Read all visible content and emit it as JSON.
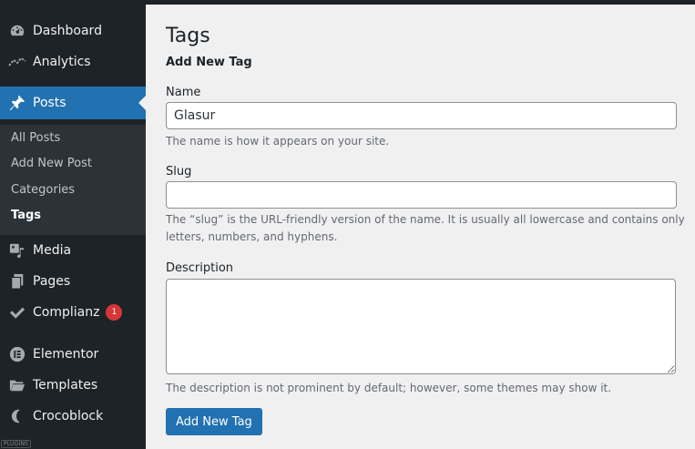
{
  "sidebar": {
    "menu": [
      {
        "label": "Dashboard",
        "icon": "dashboard-icon"
      },
      {
        "label": "Analytics",
        "icon": "analytics-icon"
      },
      {
        "label": "Posts",
        "icon": "pushpin-icon",
        "active": true
      },
      {
        "label": "Media",
        "icon": "media-icon"
      },
      {
        "label": "Pages",
        "icon": "pages-icon"
      },
      {
        "label": "Complianz",
        "icon": "checkmark-icon",
        "badge": "1"
      },
      {
        "label": "Elementor",
        "icon": "elementor-icon"
      },
      {
        "label": "Templates",
        "icon": "folder-icon"
      },
      {
        "label": "Crocoblock",
        "icon": "crocoblock-icon"
      }
    ],
    "posts_submenu": [
      "All Posts",
      "Add New Post",
      "Categories",
      "Tags"
    ],
    "current_submenu": "Tags",
    "footer_tag": "PLUGINS"
  },
  "main": {
    "page_title": "Tags",
    "form_title": "Add New Tag",
    "name": {
      "label": "Name",
      "value": "Glasur",
      "help": "The name is how it appears on your site."
    },
    "slug": {
      "label": "Slug",
      "value": "",
      "help": "The “slug” is the URL-friendly version of the name. It is usually all lowercase and contains only letters, numbers, and hyphens."
    },
    "description": {
      "label": "Description",
      "value": "",
      "help": "The description is not prominent by default; however, some themes may show it."
    },
    "submit_label": "Add New Tag"
  },
  "colors": {
    "sidebar_bg": "#1d2327",
    "submenu_bg": "#2c3338",
    "accent": "#2271b1",
    "badge": "#d63638",
    "content_bg": "#f0f0f1"
  }
}
